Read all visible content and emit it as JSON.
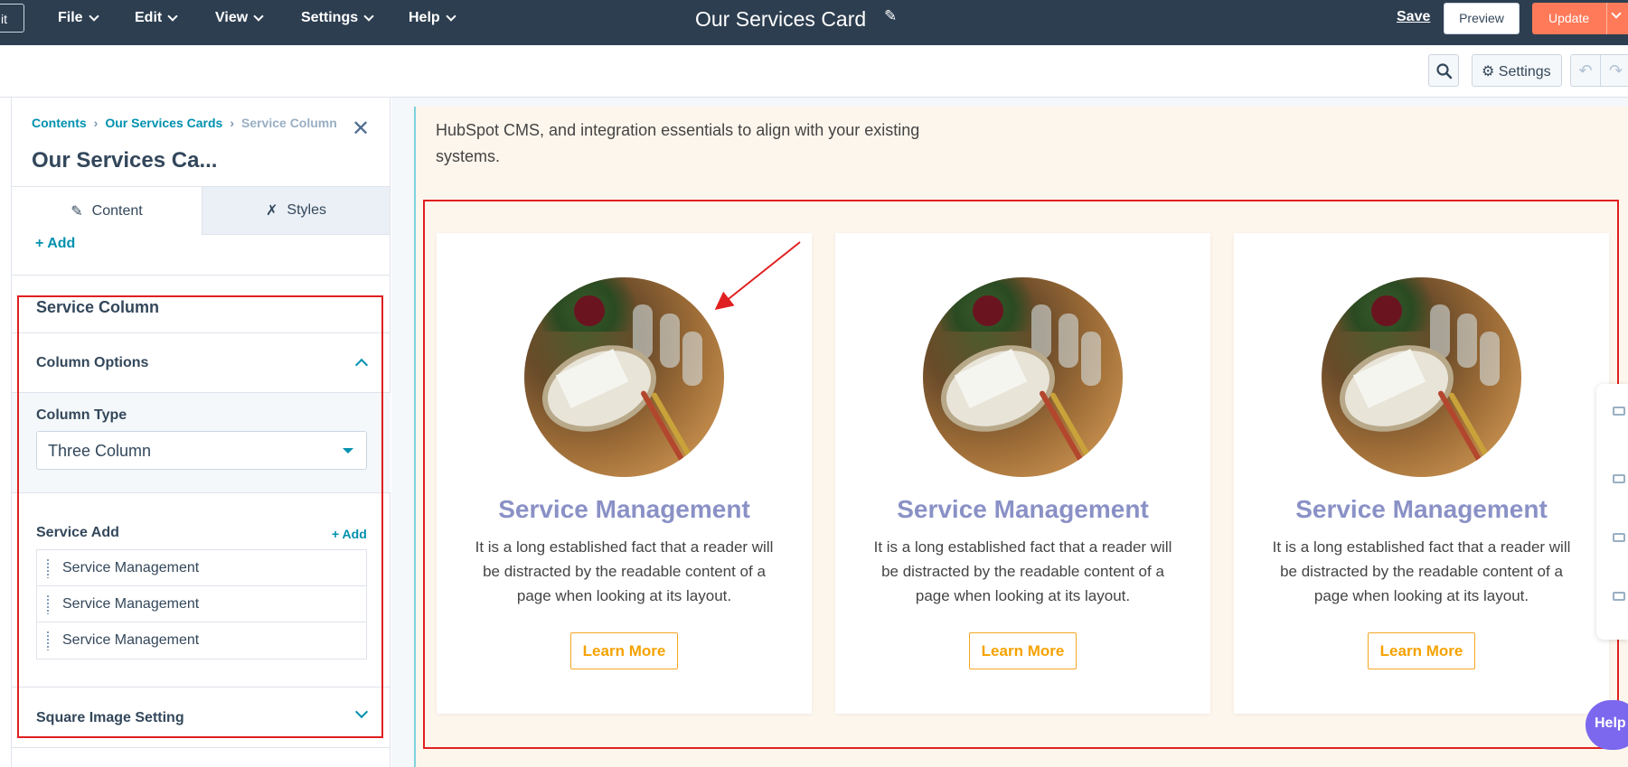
{
  "topbar": {
    "exit_label": "it",
    "menus": [
      "File",
      "Edit",
      "View",
      "Settings",
      "Help"
    ],
    "title": "Our Services Card",
    "save_label": "Save",
    "preview_label": "Preview",
    "update_label": "Update",
    "bg_color": "#2d3e50",
    "update_color": "#ff7a59"
  },
  "subbar": {
    "settings_label": "Settings"
  },
  "sidebar": {
    "breadcrumb": [
      "Contents",
      "Our Services Cards",
      "Service Column"
    ],
    "module_title": "Our Services Ca...",
    "tabs": [
      "Content",
      "Styles"
    ],
    "add_label": "Add",
    "section_title": "Service Column",
    "column_options_label": "Column Options",
    "column_type_label": "Column Type",
    "column_type_value": "Three Column",
    "service_add_label": "Service Add",
    "service_add_link": "+ Add",
    "service_items": [
      "Service Management",
      "Service Management",
      "Service Management"
    ],
    "square_image_label": "Square Image Setting"
  },
  "canvas": {
    "intro_text": "HubSpot CMS, and integration essentials to align with your existing systems.",
    "cards": [
      {
        "title": "Service Management",
        "body": "It is a long established fact that a reader will be distracted by the readable content of a page when looking at its layout.",
        "button": "Learn More"
      },
      {
        "title": "Service Management",
        "body": "It is a long established fact that a reader will be distracted by the readable content of a page when looking at its layout.",
        "button": "Learn More"
      },
      {
        "title": "Service Management",
        "body": "It is a long established fact that a reader will be distracted by the readable content of a page when looking at its layout.",
        "button": "Learn More"
      }
    ],
    "title_color": "#8a91c6",
    "button_color": "#f5a200",
    "page_bg": "#fdf6ec"
  },
  "help_label": "Help"
}
